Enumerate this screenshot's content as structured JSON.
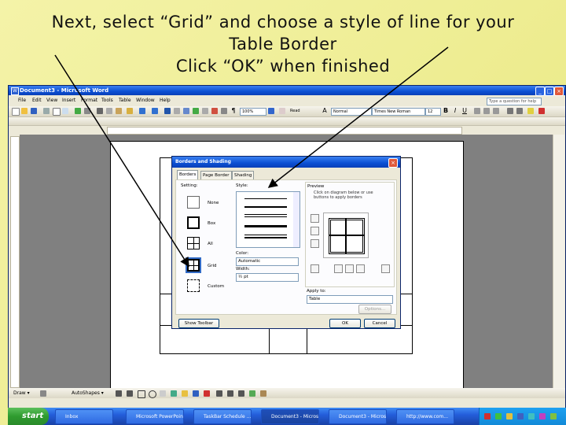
{
  "instruction": {
    "line1": "Next, select “Grid” and choose a style of line for your",
    "line2": "Table Border",
    "line3": "Click “OK” when finished"
  },
  "window": {
    "title": "Document3 - Microsoft Word",
    "minimize": "_",
    "maximize": "□",
    "close": "×"
  },
  "menubar": {
    "items": [
      "File",
      "Edit",
      "View",
      "Insert",
      "Format",
      "Tools",
      "Table",
      "Window",
      "Help"
    ],
    "help_placeholder": "Type a question for help"
  },
  "toolbar": {
    "zoom": "100%",
    "view": "Read",
    "style": "Normal",
    "font": "Times New Roman",
    "size": "12"
  },
  "dialog": {
    "title": "Borders and Shading",
    "close": "×",
    "tabs": [
      "Borders",
      "Page Border",
      "Shading"
    ],
    "setting_label": "Setting:",
    "settings": [
      "None",
      "Box",
      "All",
      "Grid",
      "Custom"
    ],
    "style_label": "Style:",
    "color_label": "Color:",
    "color_value": "Automatic",
    "width_label": "Width:",
    "width_value": "½ pt",
    "preview_label": "Preview",
    "preview_text": "Click on diagram below or use buttons to apply borders",
    "apply_label": "Apply to:",
    "apply_value": "Table",
    "options_button": "Options...",
    "show_toolbar_button": "Show Toolbar",
    "ok_button": "OK",
    "cancel_button": "Cancel"
  },
  "drawbar": {
    "draw": "Draw ▾",
    "autoshapes": "AutoShapes ▾"
  },
  "taskbar": {
    "start": "start",
    "tasks": [
      "Inbox",
      "Microsoft PowerPoint...",
      "TaskBar Schedule ...",
      "Document3 - Micros...",
      "Document3 - Micros...",
      "http://www.com..."
    ],
    "active_index": 3
  }
}
